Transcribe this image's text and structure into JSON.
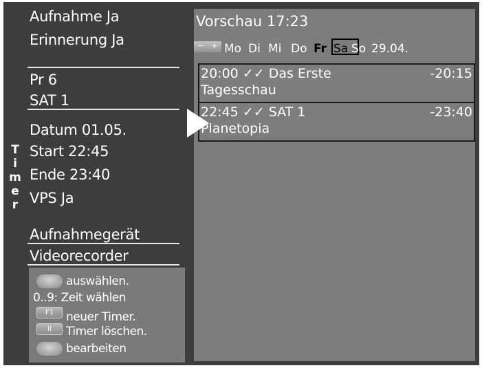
{
  "left": {
    "recording": "Aufnahme Ja",
    "reminder": "Erinnerung Ja",
    "program_number": "Pr   6",
    "channel": "SAT 1",
    "date": "Datum 01.05.",
    "start": "Start 22:45",
    "end": "Ende 23:40",
    "vps": "VPS Ja",
    "device_label": "Aufnahmegerät",
    "device_value": "Videorecorder",
    "vertical_title": [
      "T",
      "i",
      "m",
      "e",
      "r"
    ]
  },
  "help": {
    "select": "auswählen.",
    "time_select": "0..9: Zeit wählen",
    "f1_key": "F1",
    "new_timer": "neuer Timer.",
    "pause_key": "II",
    "delete_timer": "Timer löschen.",
    "edit": "bearbeiten"
  },
  "preview": {
    "title": "Vorschau 17:23",
    "minus": "−",
    "plus": "+",
    "days": [
      "Mo",
      "Di",
      "Mi",
      "Do",
      "Fr",
      "Sa",
      "So"
    ],
    "date": "29.04."
  },
  "entries": [
    {
      "start": "20:00",
      "checks": "✓✓",
      "channel": "Das Erste",
      "end": "-20:15",
      "title": "Tagesschau"
    },
    {
      "start": "22:45",
      "checks": "✓✓",
      "channel": "SAT 1",
      "end": "-23:40",
      "title": "Planetopia"
    }
  ],
  "colors": {
    "panel_dark": "#3d3d3d",
    "panel_gray": "#7d7d7d",
    "help_gray": "#7a7a7a",
    "text": "#ffffff"
  }
}
